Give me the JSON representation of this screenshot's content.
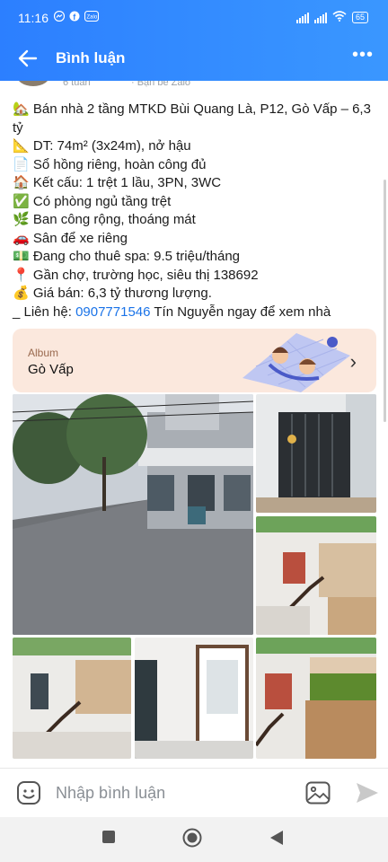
{
  "status_bar": {
    "time": "11:16",
    "battery": "65"
  },
  "header": {
    "title": "Bình luận"
  },
  "post_meta": {
    "time_ago": "6 tuần",
    "partial": "· Bạn bè Zalo"
  },
  "post": {
    "lines": [
      {
        "icon": "🏡",
        "text": "Bán nhà 2 tầng MTKD Bùi Quang Là, P12, Gò Vấp – 6,3 tỷ"
      },
      {
        "icon": "📐",
        "text": "DT: 74m² (3x24m), nở hậu"
      },
      {
        "icon": "📄",
        "text": "Sổ hồng riêng, hoàn công đủ"
      },
      {
        "icon": "🏠",
        "text": "Kết cấu: 1 trệt 1 lầu, 3PN, 3WC"
      },
      {
        "icon": "✅",
        "text": "Có phòng ngủ tầng trệt"
      },
      {
        "icon": "🌿",
        "text": "Ban công rộng, thoáng mát"
      },
      {
        "icon": "🚗",
        "text": "Sân để xe riêng"
      },
      {
        "icon": "💵",
        "text": "Đang cho thuê spa: 9.5 triệu/tháng"
      },
      {
        "icon": "📍",
        "text": "Gần chợ, trường học, siêu thị 138692"
      },
      {
        "icon": "💰",
        "text": "Giá bán: 6,3 tỷ thương lượng."
      }
    ],
    "contact_prefix": "_ Liên hệ: ",
    "phone": "0907771546",
    "contact_suffix": " Tín Nguyễn ngay để xem nhà"
  },
  "album": {
    "label": "Album",
    "name": "Gò Vấp"
  },
  "comment_bar": {
    "placeholder": "Nhập bình luận"
  },
  "colors": {
    "header_blue": "#2f86ff",
    "link_blue": "#1a73e8",
    "album_bg": "#fbe8dd"
  }
}
